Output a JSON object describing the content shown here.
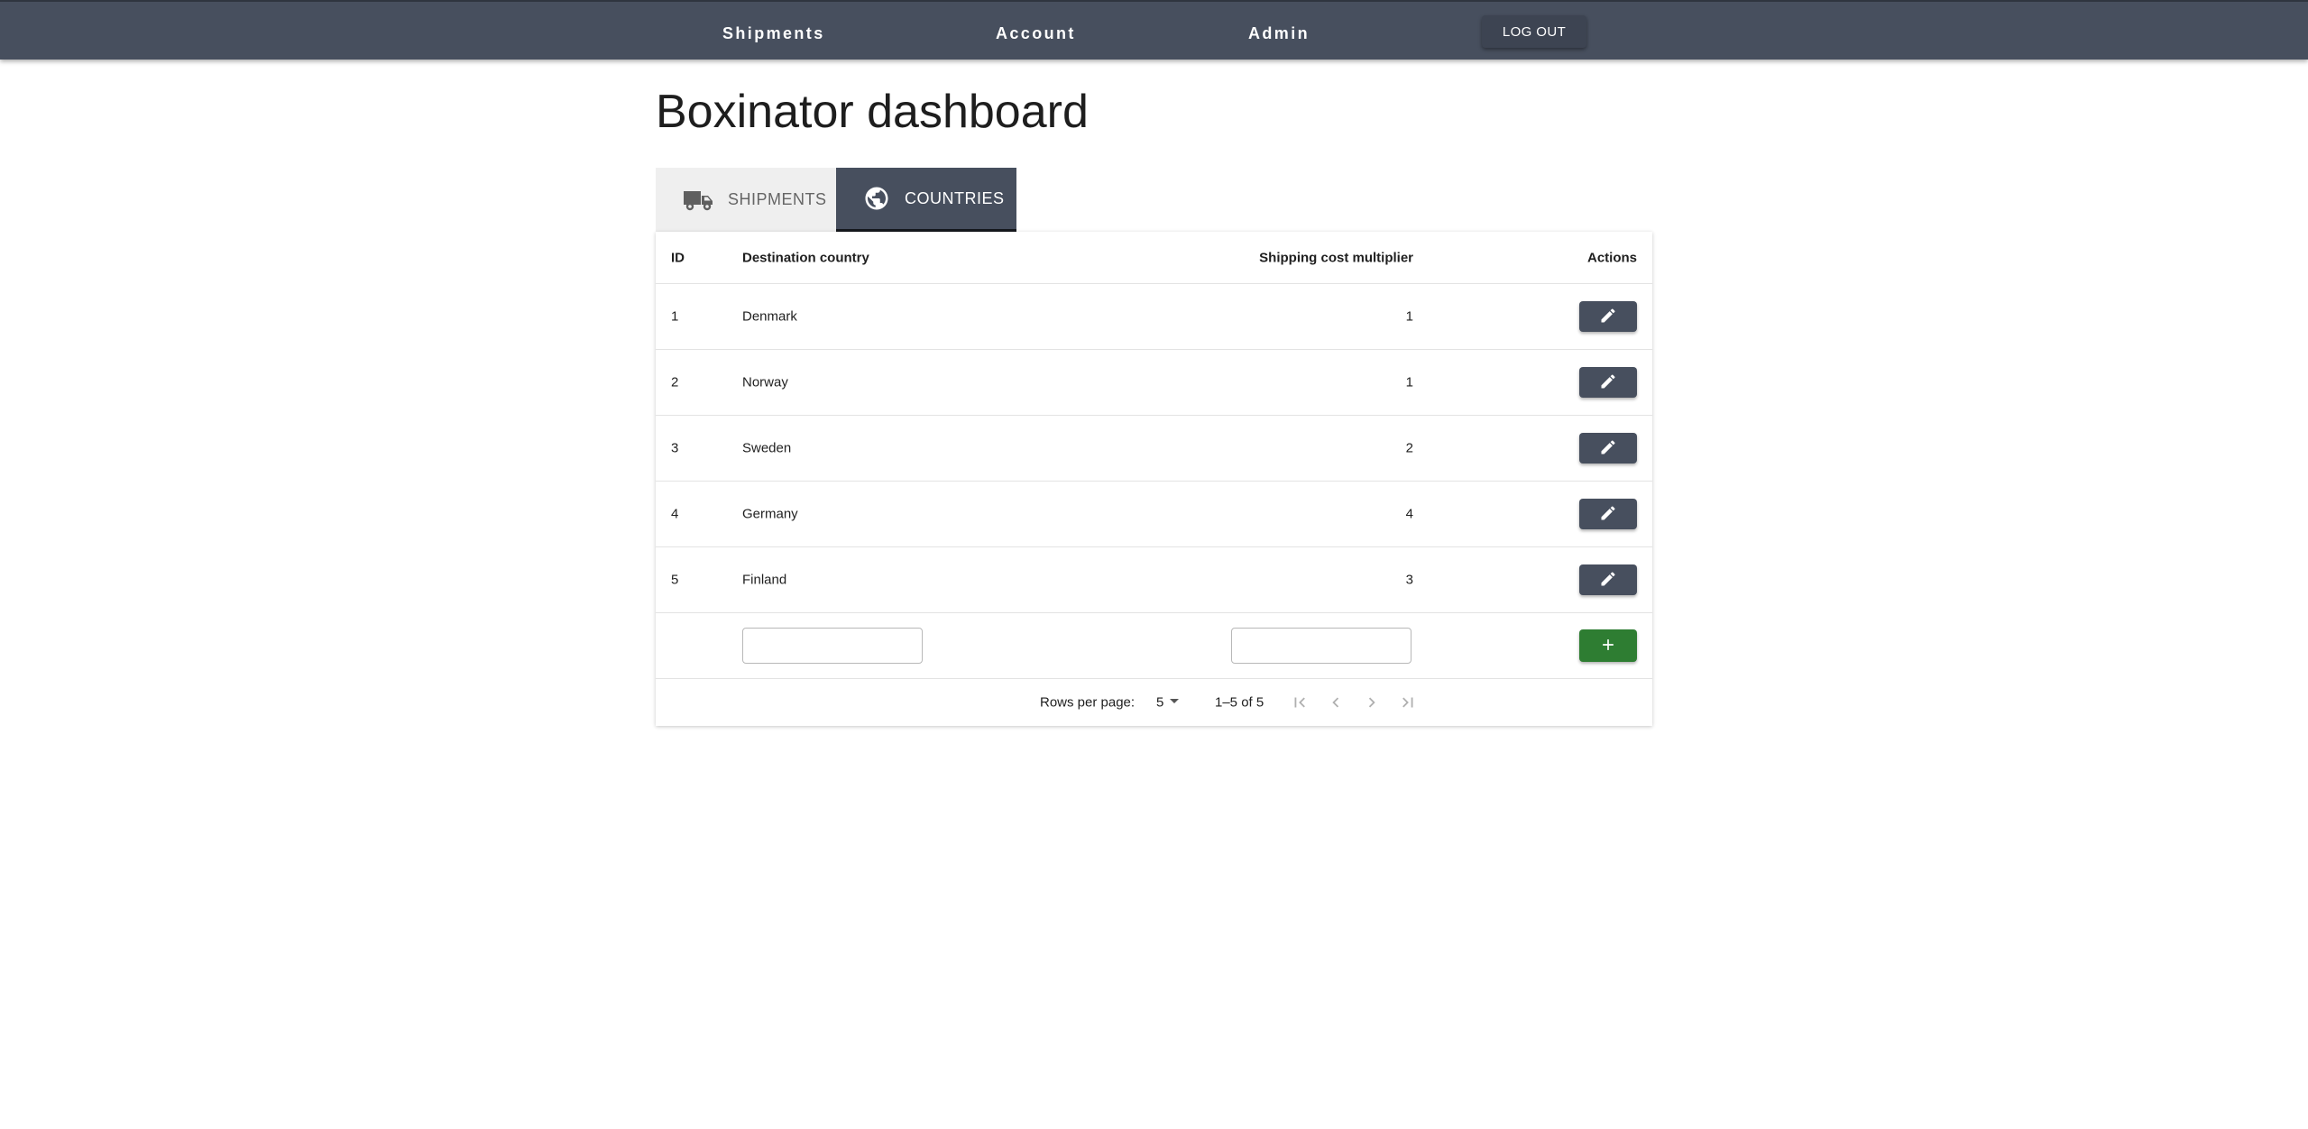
{
  "nav": {
    "links": [
      "Shipments",
      "Account",
      "Admin"
    ],
    "logout_label": "LOG OUT"
  },
  "page": {
    "title": "Boxinator dashboard"
  },
  "tabs": [
    {
      "label": "SHIPMENTS",
      "icon": "truck-icon",
      "active": false
    },
    {
      "label": "COUNTRIES",
      "icon": "globe-icon",
      "active": true
    }
  ],
  "table": {
    "headers": {
      "id": "ID",
      "country": "Destination country",
      "multiplier": "Shipping cost multiplier",
      "actions": "Actions"
    },
    "rows": [
      {
        "id": "1",
        "country": "Denmark",
        "multiplier": "1"
      },
      {
        "id": "2",
        "country": "Norway",
        "multiplier": "1"
      },
      {
        "id": "3",
        "country": "Sweden",
        "multiplier": "2"
      },
      {
        "id": "4",
        "country": "Germany",
        "multiplier": "4"
      },
      {
        "id": "5",
        "country": "Finland",
        "multiplier": "3"
      }
    ],
    "new_row": {
      "country_value": "",
      "multiplier_value": ""
    }
  },
  "pagination": {
    "rows_per_page_label": "Rows per page:",
    "rows_per_page_value": "5",
    "range_label": "1–5 of 5"
  },
  "colors": {
    "nav_bg": "#474f5e",
    "add_button": "#2e7d32",
    "edit_button": "#474f5e"
  }
}
